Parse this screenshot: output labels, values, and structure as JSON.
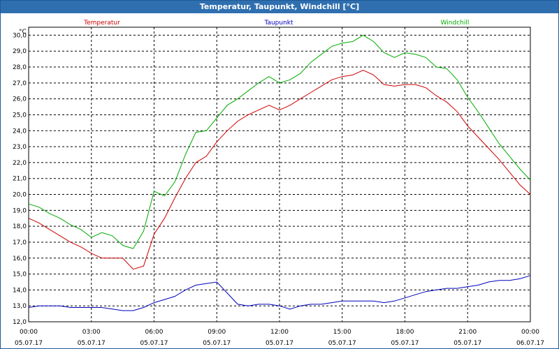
{
  "window": {
    "title": "Temperatur, Taupunkt, Windchill [°C]"
  },
  "chart_data": {
    "type": "line",
    "title": "Temperatur, Taupunkt, Windchill [°C]",
    "ylabel": "°C",
    "ylim": [
      12.0,
      30.5
    ],
    "yticks": [
      "12,0",
      "13,0",
      "14,0",
      "15,0",
      "16,0",
      "17,0",
      "18,0",
      "19,0",
      "20,0",
      "21,0",
      "22,0",
      "23,0",
      "24,0",
      "25,0",
      "26,0",
      "27,0",
      "28,0",
      "29,0",
      "30,0"
    ],
    "xlim": [
      0,
      24
    ],
    "xticks": [
      {
        "time": "00:00",
        "date": "05.07.17"
      },
      {
        "time": "03:00",
        "date": "05.07.17"
      },
      {
        "time": "06:00",
        "date": "05.07.17"
      },
      {
        "time": "09:00",
        "date": "05.07.17"
      },
      {
        "time": "12:00",
        "date": "05.07.17"
      },
      {
        "time": "15:00",
        "date": "05.07.17"
      },
      {
        "time": "18:00",
        "date": "05.07.17"
      },
      {
        "time": "21:00",
        "date": "05.07.17"
      },
      {
        "time": "00:00",
        "date": "06.07.17"
      }
    ],
    "grid": true,
    "legend_position": "top",
    "series": [
      {
        "name": "Temperatur",
        "color": "#cc0000",
        "x": [
          0,
          0.5,
          1,
          1.5,
          2,
          2.5,
          3,
          3.5,
          4,
          4.5,
          5,
          5.5,
          6,
          6.5,
          7,
          7.5,
          8,
          8.5,
          9,
          9.5,
          10,
          10.5,
          11,
          11.5,
          12,
          12.5,
          13,
          13.5,
          14,
          14.5,
          15,
          15.5,
          16,
          16.5,
          17,
          17.5,
          18,
          18.5,
          19,
          19.5,
          20,
          20.5,
          21,
          21.5,
          22,
          22.5,
          23,
          23.5,
          24
        ],
        "values": [
          18.5,
          18.2,
          17.8,
          17.4,
          17.0,
          16.7,
          16.3,
          16.0,
          16.0,
          16.0,
          15.3,
          15.5,
          17.5,
          18.5,
          19.8,
          21.0,
          22.0,
          22.4,
          23.3,
          24.0,
          24.6,
          25.0,
          25.3,
          25.6,
          25.3,
          25.6,
          26.0,
          26.4,
          26.8,
          27.2,
          27.4,
          27.5,
          27.8,
          27.5,
          26.9,
          26.8,
          26.9,
          26.9,
          26.7,
          26.2,
          25.8,
          25.2,
          24.3,
          23.6,
          22.9,
          22.2,
          21.4,
          20.6,
          20.0
        ]
      },
      {
        "name": "Taupunkt",
        "color": "#0000bb",
        "x": [
          0,
          0.5,
          1,
          1.5,
          2,
          2.5,
          3,
          3.5,
          4,
          4.5,
          5,
          5.5,
          6,
          6.5,
          7,
          7.5,
          8,
          8.5,
          9,
          9.5,
          10,
          10.5,
          11,
          11.5,
          12,
          12.5,
          13,
          13.5,
          14,
          14.5,
          15,
          15.5,
          16,
          16.5,
          17,
          17.5,
          18,
          18.5,
          19,
          19.5,
          20,
          20.5,
          21,
          21.5,
          22,
          22.5,
          23,
          23.5,
          24
        ],
        "values": [
          12.9,
          13.0,
          13.0,
          13.0,
          12.9,
          12.9,
          12.9,
          12.9,
          12.8,
          12.7,
          12.7,
          12.9,
          13.2,
          13.4,
          13.6,
          14.0,
          14.3,
          14.4,
          14.5,
          13.8,
          13.1,
          13.0,
          13.1,
          13.1,
          13.0,
          12.8,
          13.0,
          13.1,
          13.1,
          13.2,
          13.3,
          13.3,
          13.3,
          13.3,
          13.2,
          13.3,
          13.5,
          13.7,
          13.9,
          14.0,
          14.1,
          14.1,
          14.2,
          14.3,
          14.5,
          14.6,
          14.6,
          14.7,
          14.9
        ]
      },
      {
        "name": "Windchill",
        "color": "#00aa00",
        "x": [
          0,
          0.5,
          1,
          1.5,
          2,
          2.5,
          3,
          3.5,
          4,
          4.5,
          5,
          5.5,
          6,
          6.5,
          7,
          7.5,
          8,
          8.5,
          9,
          9.5,
          10,
          10.5,
          11,
          11.5,
          12,
          12.5,
          13,
          13.5,
          14,
          14.5,
          15,
          15.5,
          16,
          16.5,
          17,
          17.5,
          18,
          18.5,
          19,
          19.5,
          20,
          20.5,
          21,
          21.5,
          22,
          22.5,
          23,
          23.5,
          24
        ],
        "values": [
          19.4,
          19.2,
          18.8,
          18.5,
          18.1,
          17.8,
          17.3,
          17.6,
          17.4,
          16.8,
          16.6,
          17.7,
          20.2,
          19.9,
          20.8,
          22.5,
          23.9,
          24.0,
          24.8,
          25.6,
          26.0,
          26.5,
          27.0,
          27.4,
          27.0,
          27.2,
          27.6,
          28.3,
          28.8,
          29.3,
          29.5,
          29.6,
          30.0,
          29.6,
          28.9,
          28.6,
          28.9,
          28.8,
          28.6,
          28.0,
          27.9,
          27.2,
          26.1,
          25.2,
          24.2,
          23.2,
          22.4,
          21.6,
          20.9
        ]
      }
    ]
  }
}
